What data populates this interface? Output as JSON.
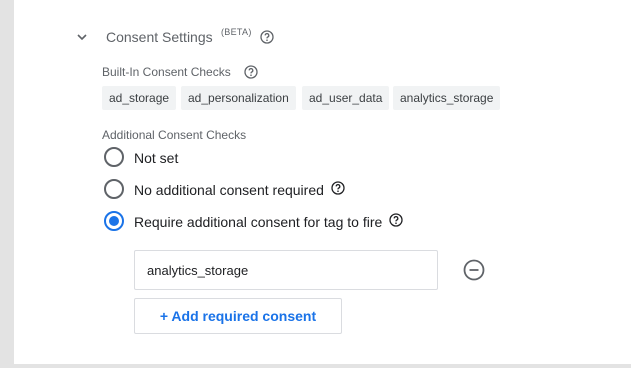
{
  "section": {
    "title": "Consent Settings",
    "badge": "(BETA)"
  },
  "builtin": {
    "label": "Built-In Consent Checks",
    "chips": [
      "ad_storage",
      "ad_personalization",
      "ad_user_data",
      "analytics_storage"
    ]
  },
  "additional": {
    "label": "Additional Consent Checks",
    "options": [
      {
        "label": "Not set",
        "checked": false
      },
      {
        "label": "No additional consent required",
        "checked": false
      },
      {
        "label": "Require additional consent for tag to fire",
        "checked": true
      }
    ],
    "consent_value": "analytics_storage",
    "add_button_label": "+ Add required consent"
  },
  "icons": {
    "collapse": "chevron-down-icon",
    "help": "help-circle-icon",
    "remove": "remove-circle-icon"
  },
  "colors": {
    "accent": "#1a73e8",
    "chip_background": "#f1f3f4",
    "muted_text": "#5f6368"
  }
}
